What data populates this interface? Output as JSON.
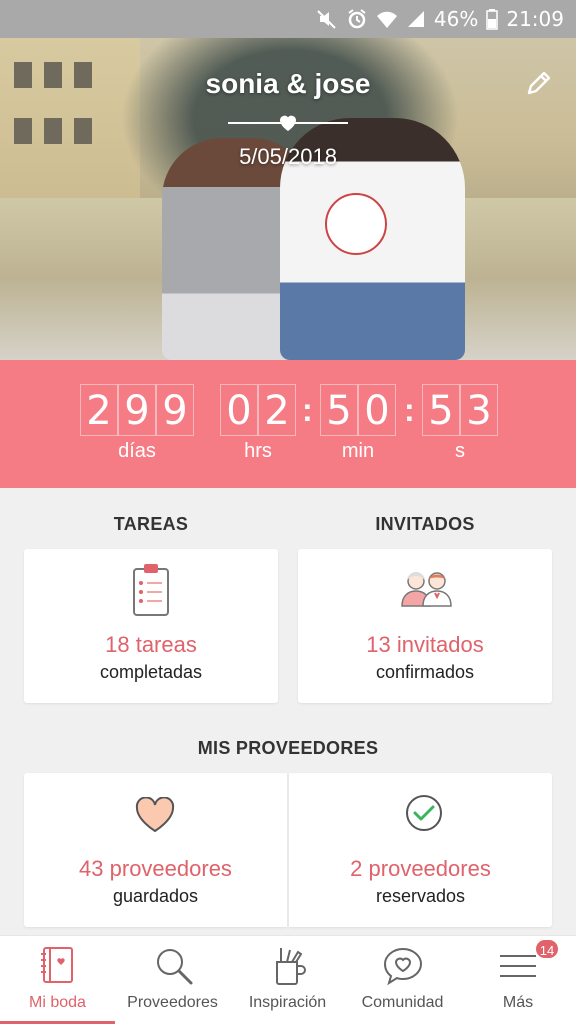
{
  "status_bar": {
    "battery": "46%",
    "time": "21:09"
  },
  "hero": {
    "couple_name": "sonia & jose",
    "date": "5/05/2018"
  },
  "countdown": {
    "days_digits": [
      "2",
      "9",
      "9"
    ],
    "hours_digits": [
      "0",
      "2"
    ],
    "minutes_digits": [
      "5",
      "0"
    ],
    "seconds_digits": [
      "5",
      "3"
    ],
    "labels": {
      "days": "días",
      "hours": "hrs",
      "minutes": "min",
      "seconds": "s"
    }
  },
  "tareas": {
    "title": "TAREAS",
    "count_label": "18 tareas",
    "sub_label": "completadas"
  },
  "invitados": {
    "title": "INVITADOS",
    "count_label": "13 invitados",
    "sub_label": "confirmados"
  },
  "proveedores": {
    "title": "MIS PROVEEDORES",
    "saved": {
      "count_label": "43 proveedores",
      "sub_label": "guardados"
    },
    "booked": {
      "count_label": "2 proveedores",
      "sub_label": "reservados"
    }
  },
  "nav": {
    "items": [
      {
        "label": "Mi boda",
        "icon": "notebook-icon",
        "active": true
      },
      {
        "label": "Proveedores",
        "icon": "search-icon"
      },
      {
        "label": "Inspiración",
        "icon": "pencil-cup-icon"
      },
      {
        "label": "Comunidad",
        "icon": "chat-heart-icon"
      },
      {
        "label": "Más",
        "icon": "menu-icon"
      }
    ],
    "badge": "14"
  },
  "colors": {
    "accent": "#e0626a",
    "countdown_bg": "#f57c85"
  }
}
